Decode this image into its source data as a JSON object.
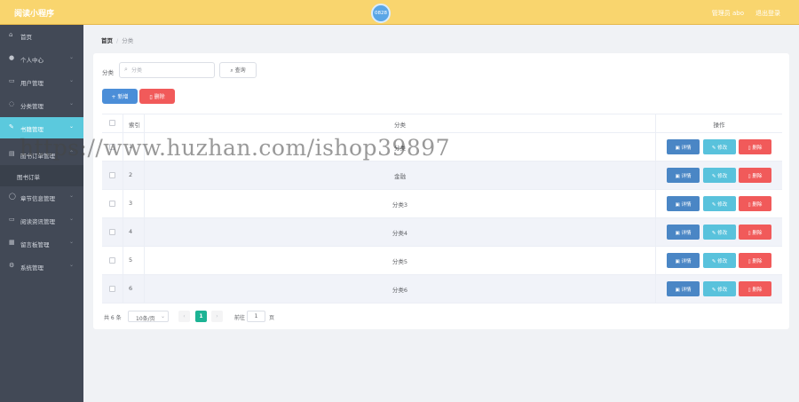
{
  "header": {
    "title": "阅读小程序",
    "avatar_text": "0828",
    "user_label": "管理员 abo",
    "logout_label": "退出登录"
  },
  "sidebar": {
    "items": [
      {
        "label": "首页",
        "icon": "home-icon"
      },
      {
        "label": "个人中心",
        "icon": "user-icon"
      },
      {
        "label": "用户管理",
        "icon": "users-icon"
      },
      {
        "label": "分类管理",
        "icon": "tag-icon"
      },
      {
        "label": "书籍管理",
        "icon": "book-icon",
        "active": true
      },
      {
        "label": "图书订单管理",
        "icon": "order-icon"
      },
      {
        "label": "图书订单",
        "sub": true
      },
      {
        "label": "章节信息管理",
        "icon": "chapter-icon"
      },
      {
        "label": "阅读资讯管理",
        "icon": "news-icon"
      },
      {
        "label": "留言板管理",
        "icon": "message-icon"
      },
      {
        "label": "系统管理",
        "icon": "gear-icon"
      }
    ]
  },
  "breadcrumb": {
    "home": "首页",
    "separator": "/",
    "current": "分类"
  },
  "search": {
    "label": "分类",
    "placeholder": "分类",
    "query_label": "查询"
  },
  "actions": {
    "add_label": "+ 新增",
    "delete_label": "删除"
  },
  "table": {
    "headers": {
      "index": "索引",
      "name": "分类",
      "ops": "操作"
    },
    "rows": [
      {
        "index": "1",
        "name": "分类"
      },
      {
        "index": "2",
        "name": "金融"
      },
      {
        "index": "3",
        "name": "分类3"
      },
      {
        "index": "4",
        "name": "分类4"
      },
      {
        "index": "5",
        "name": "分类5"
      },
      {
        "index": "6",
        "name": "分类6"
      }
    ],
    "op_labels": {
      "detail": "详情",
      "edit": "修改",
      "remove": "删除"
    }
  },
  "pagination": {
    "total": "共 6 条",
    "page_size": "10条/页",
    "current_page": "1",
    "goto_label": "前往",
    "goto_value": "1",
    "page_unit": "页"
  },
  "watermark": "https://www.huzhan.com/ishop39897",
  "colors": {
    "header": "#f9d56e",
    "sidebar": "#424956",
    "active": "#5bc9dd",
    "primary": "#4b8ed8",
    "danger": "#f15a5a",
    "page_active": "#1cb394"
  }
}
